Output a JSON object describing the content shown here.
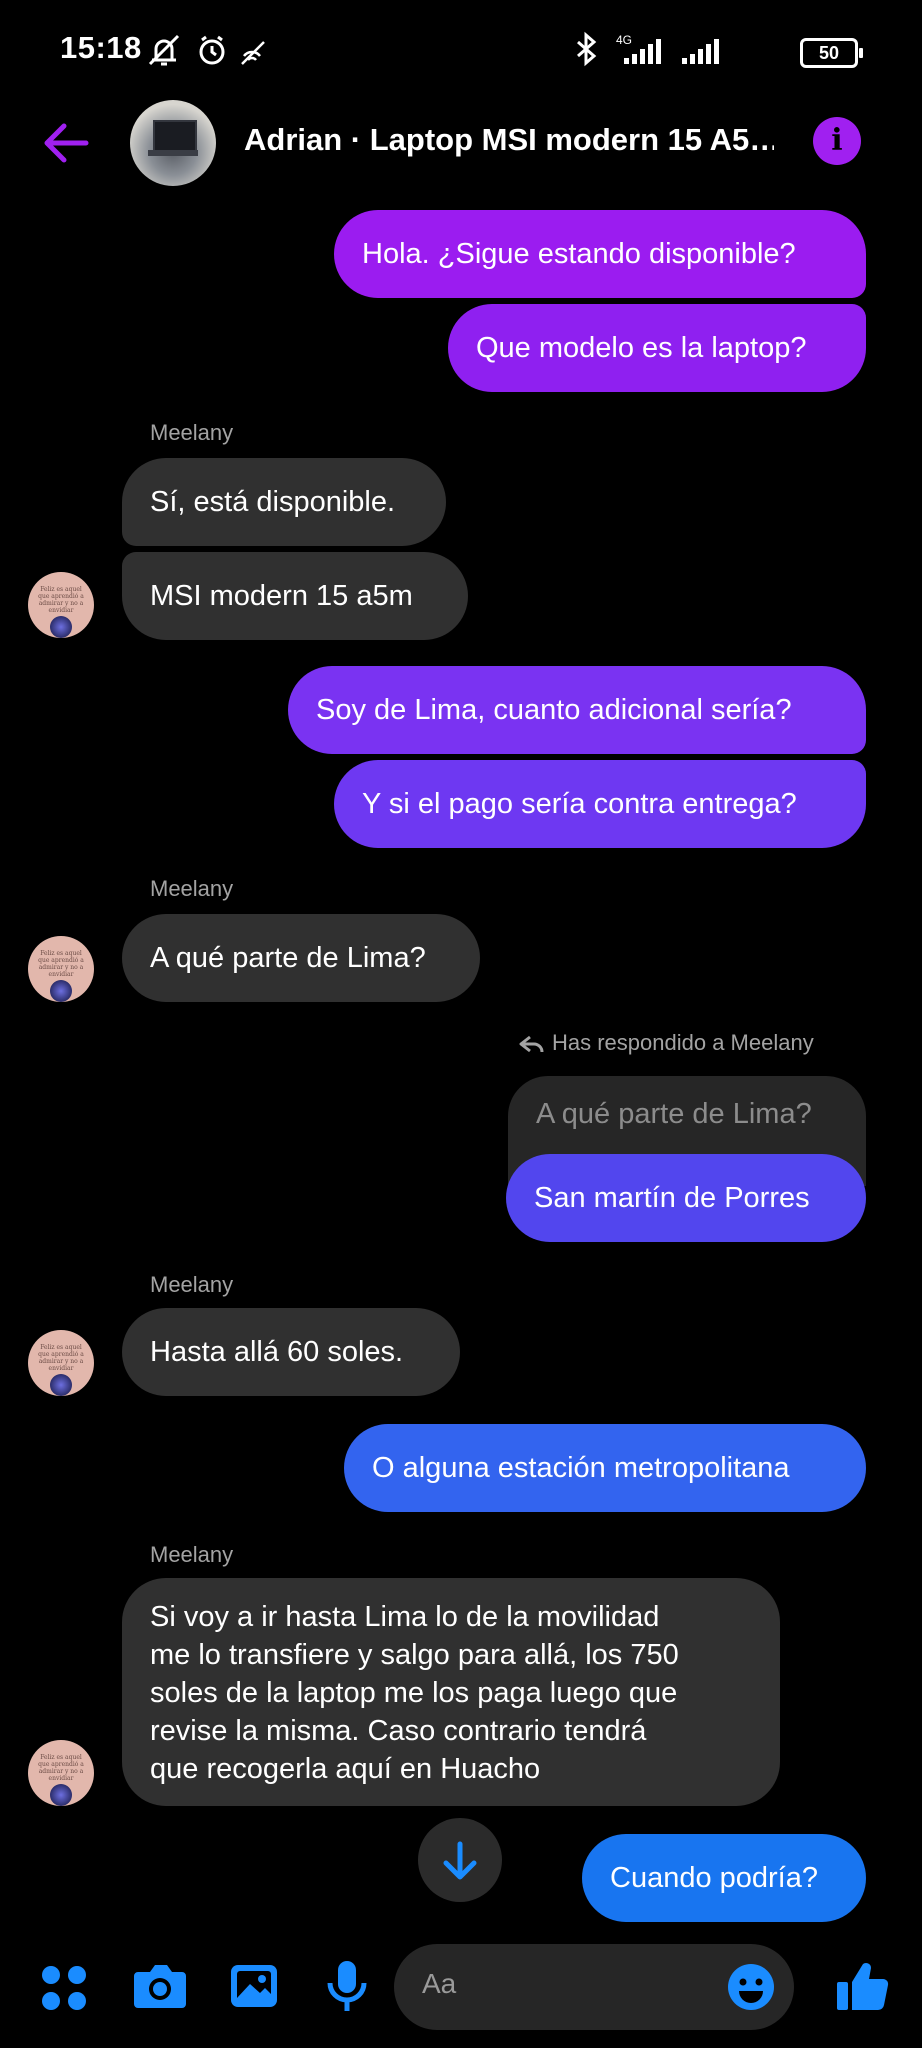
{
  "status_bar": {
    "time": "15:18",
    "network": "4G",
    "battery": "50"
  },
  "header": {
    "title": "Adrian · Laptop MSI modern 15 A5…"
  },
  "messages": [
    {
      "text": "Hola. ¿Sigue estando disponible?"
    },
    {
      "text": "Que modelo es la laptop?"
    },
    {
      "sender": "Meelany"
    },
    {
      "text": "Sí, está disponible."
    },
    {
      "text": "MSI modern 15 a5m"
    },
    {
      "text": "Soy de Lima, cuanto adicional sería?"
    },
    {
      "text": "Y si el pago sería contra entrega?"
    },
    {
      "sender": "Meelany"
    },
    {
      "text": "A qué parte de Lima?"
    },
    {
      "reply_note": "Has respondido a Meelany",
      "quote": "A qué parte de Lima?"
    },
    {
      "text": "San martín de Porres"
    },
    {
      "sender": "Meelany"
    },
    {
      "text": "Hasta allá 60 soles."
    },
    {
      "text": "O alguna estación metropolitana"
    },
    {
      "sender": "Meelany"
    },
    {
      "lines": [
        "Si voy a ir hasta Lima lo de la movilidad",
        "me lo transfiere y salgo para allá, los 750",
        "soles de la laptop me los paga luego que",
        "revise la misma. Caso contrario tendrá",
        "que recogerla aquí en Huacho"
      ]
    },
    {
      "text": "Cuando podría?"
    }
  ],
  "composer": {
    "placeholder": "Aa"
  },
  "colors": {
    "accent": "#a020f0",
    "sent_gradient": [
      "#9b1cf0",
      "#7a33f2",
      "#5246ee",
      "#3364ef",
      "#1875f0"
    ],
    "received": "#303030",
    "composer_icons": "#0a84ff"
  }
}
